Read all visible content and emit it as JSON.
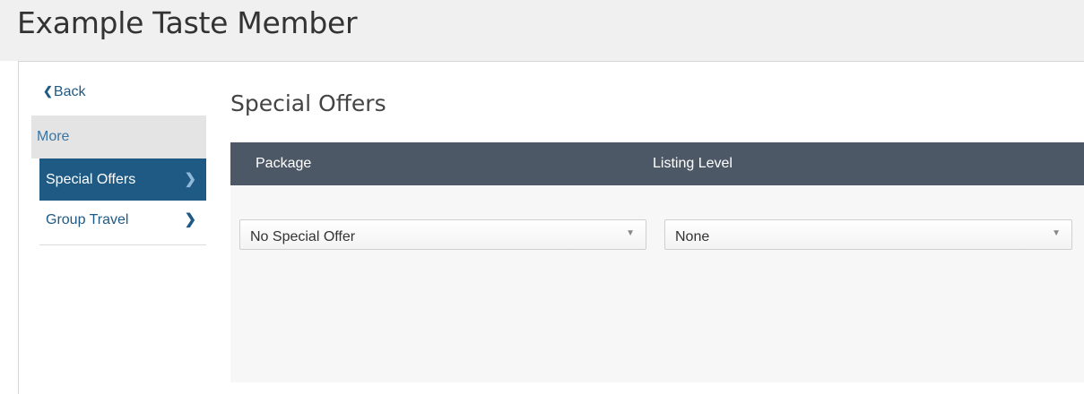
{
  "header": {
    "title": "Example Taste Member"
  },
  "sidebar": {
    "back_label": "Back",
    "section_label": "More",
    "items": [
      {
        "label": "Special Offers",
        "active": true
      },
      {
        "label": "Group Travel",
        "active": false
      }
    ]
  },
  "main": {
    "title": "Special Offers",
    "table": {
      "columns": [
        "Package",
        "Listing Level"
      ],
      "row": {
        "package": "No Special Offer",
        "listing_level": "None"
      }
    }
  },
  "icons": {
    "back": "chevron-left-icon",
    "nav_arrow": "chevron-right-icon",
    "dropdown": "caret-down-icon"
  },
  "colors": {
    "accent": "#1f5a85",
    "table_header": "#4d5866",
    "section_bg": "#e4e4e4"
  }
}
